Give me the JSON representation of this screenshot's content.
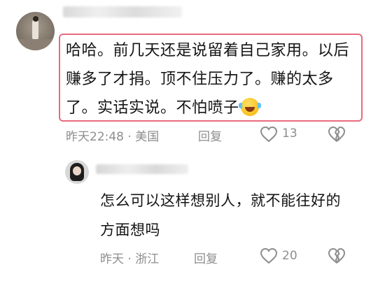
{
  "comment": {
    "text": "哈哈。前几天还是说留着自己家用。以后赚多了才捐。顶不住压力了。赚的太多了。实话实说。不怕喷子",
    "emoji": "crying-laughing-emoji",
    "time_location": "昨天22:48 · 美国",
    "reply_label": "回复",
    "like_count": "13"
  },
  "reply": {
    "text": "怎么可以这样想别人，就不能往好的方面想吗",
    "time_location": "昨天 · 浙江",
    "reply_label": "回复",
    "like_count": "20"
  },
  "colors": {
    "highlight_border": "#e86a7f",
    "meta_text": "#8d8d8d",
    "body_text": "#141414"
  }
}
